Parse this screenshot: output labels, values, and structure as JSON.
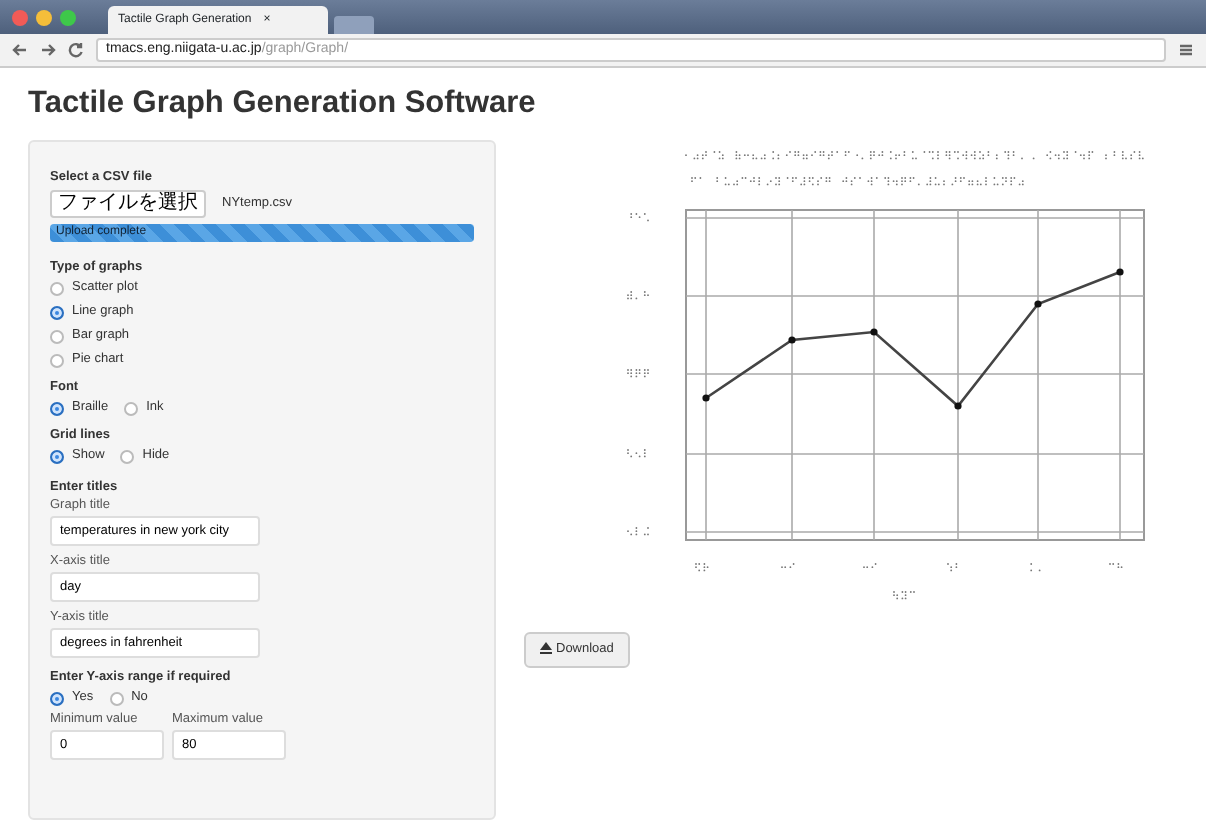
{
  "browser": {
    "tab_title": "Tactile Graph Generation",
    "tab_close": "×",
    "url_host": "tmacs.eng.niigata-u.ac.jp",
    "url_path": "/graph/Graph/"
  },
  "page_title": "Tactile Graph Generation Software",
  "form": {
    "csv": {
      "label": "Select a CSV file",
      "button": "ファイルを選択",
      "file_name": "NYtemp.csv",
      "progress": "Upload complete",
      "level": 1
    },
    "groups": [
      {
        "label": "Type of graphs",
        "kind": "stacked",
        "options": [
          {
            "label": "Scatter plot",
            "selected": false
          },
          {
            "label": "Line graph",
            "selected": true
          },
          {
            "label": "Bar graph",
            "selected": false
          },
          {
            "label": "Pie chart",
            "selected": false
          }
        ]
      },
      {
        "label": "Font",
        "kind": "inline",
        "options": [
          {
            "label": "Braille",
            "selected": true
          },
          {
            "label": "Ink",
            "selected": false
          }
        ]
      },
      {
        "label": "Grid lines",
        "kind": "inline",
        "options": [
          {
            "label": "Show",
            "selected": true
          },
          {
            "label": "Hide",
            "selected": false
          }
        ]
      }
    ],
    "titles_heading": "Enter titles",
    "titles": [
      {
        "label": "Graph title",
        "value": "temperatures in new york city"
      },
      {
        "label": "X-axis title",
        "value": "day"
      },
      {
        "label": "Y-axis title",
        "value": "degrees in fahrenheit"
      }
    ],
    "range": {
      "label": "Enter Y-axis range if required",
      "options": [
        {
          "label": "Yes",
          "selected": true
        },
        {
          "label": "No",
          "selected": false
        }
      ],
      "fields": [
        {
          "label": "Minimum value",
          "value": "0"
        },
        {
          "label": "Maximum value",
          "value": "80"
        }
      ]
    }
  },
  "download": {
    "label": "Download"
  }
}
